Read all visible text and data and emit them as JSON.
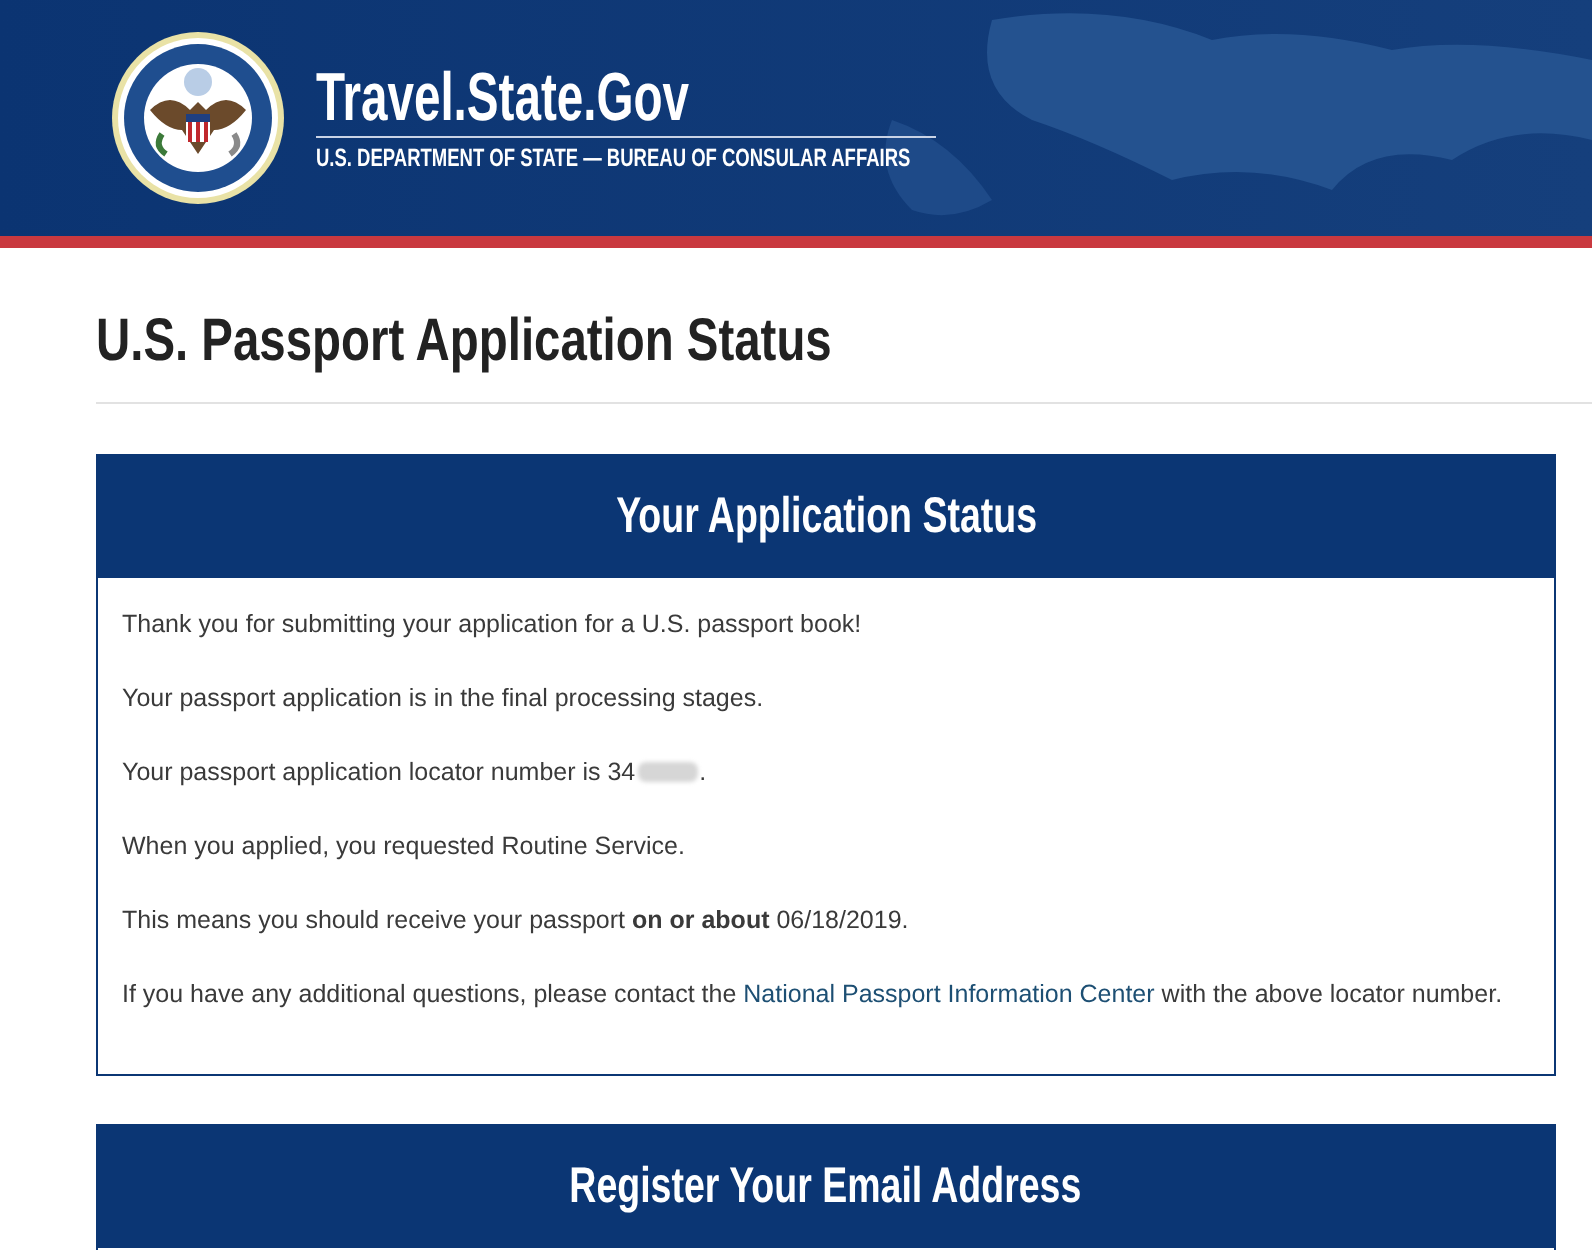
{
  "header": {
    "site_title": "Travel.State.Gov",
    "site_subtitle": "U.S. DEPARTMENT OF STATE — BUREAU OF CONSULAR AFFAIRS"
  },
  "page_title": "U.S. Passport Application Status",
  "status_panel": {
    "heading": "Your Application Status",
    "paragraphs": [
      {
        "kind": "text",
        "text": "Thank you for submitting your application for a U.S. passport book!"
      },
      {
        "kind": "text",
        "text": "Your passport application is in the final processing stages."
      },
      {
        "kind": "redacted",
        "before": "Your passport application locator number is 34",
        "after": "."
      },
      {
        "kind": "text",
        "text": "When you applied, you requested Routine Service."
      },
      {
        "kind": "text",
        "text": "This means you should receive your passport **on or about** 06/18/2019."
      },
      {
        "kind": "link",
        "before": "If you have any additional questions, please contact the",
        "link": "National Passport Information Center",
        "after": "with the above locator number."
      }
    ]
  },
  "email_panel": {
    "heading": "Register Your Email Address"
  }
}
